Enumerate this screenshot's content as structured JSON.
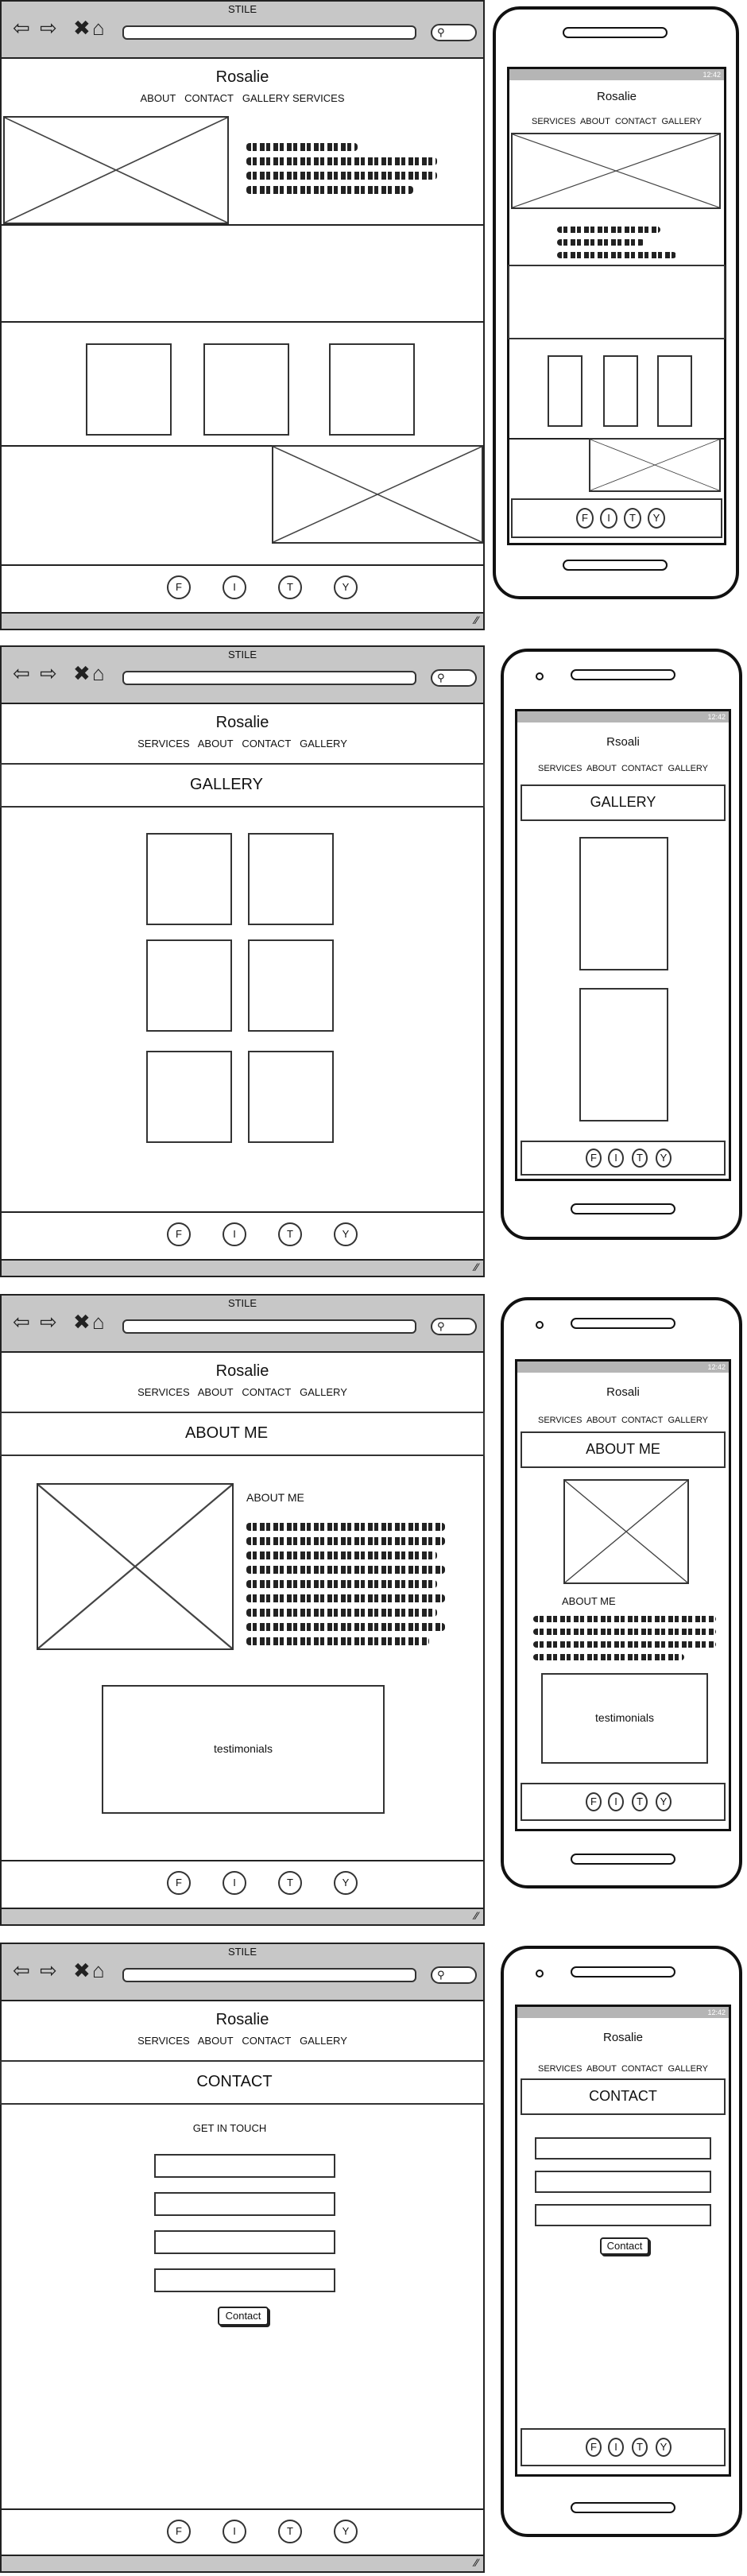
{
  "browser_title": "STILE",
  "brand_desktop": "Rosalie",
  "brand_mobile_home": "Rosalie",
  "brand_mobile_gallery": "Rsoali",
  "brand_mobile_about": "Rosali",
  "brand_mobile_contact": "Rosalie",
  "status_time": "12:42",
  "nav_home": [
    "ABOUT",
    "CONTACT",
    "GALLERY",
    "SERVICES"
  ],
  "nav_main": [
    "SERVICES",
    "ABOUT",
    "CONTACT",
    "GALLERY"
  ],
  "social": [
    "F",
    "I",
    "T",
    "Y"
  ],
  "gallery_title": "GALLERY",
  "about_title": "ABOUT ME",
  "about_heading": "ABOUT ME",
  "testimonials": "testimonials",
  "contact_title": "CONTACT",
  "get_in_touch": "GET IN TOUCH",
  "contact_button": "Contact",
  "colors": {
    "chrome": "#c7c7c7",
    "stroke": "#222222",
    "status": "#b5b5b5"
  }
}
